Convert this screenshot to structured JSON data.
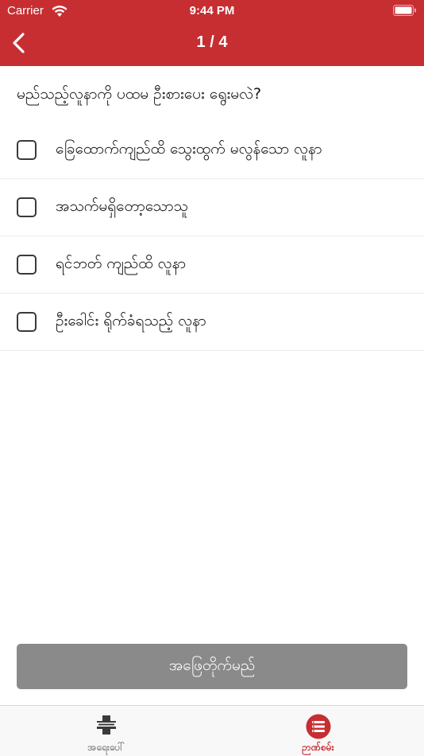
{
  "status_bar": {
    "carrier": "Carrier",
    "time": "9:44 PM",
    "wifi_icon": "wifi-icon",
    "battery_icon": "battery-icon"
  },
  "navbar": {
    "back_icon": "chevron-left-icon",
    "counter": "1 / 4",
    "background_color": "#c62e32"
  },
  "question": {
    "text": "မည်သည့်လူနာကို ပထမ ဦးစားပေး ရွေးမလဲ?"
  },
  "options": [
    {
      "label": "ခြေထောက်ကျည်ထိ သွေးထွက် မလွန်သော လူနာ",
      "checked": false
    },
    {
      "label": "အသက်မရှိတော့သောသူ",
      "checked": false
    },
    {
      "label": "ရင်ဘတ် ကျည်ထိ လူနာ",
      "checked": false
    },
    {
      "label": "ဦးခေါင်း ရိုက်ခံရသည့် လူနာ",
      "checked": false
    }
  ],
  "submit_button": {
    "label": "အဖြေတိုက်မည်",
    "color": "#8a8a8a"
  },
  "tabbar": {
    "tabs": [
      {
        "label": "အရေးပေါ်",
        "icon": "medical-cross-icon",
        "active": false
      },
      {
        "label": "ဉာဏ်စမ်း",
        "icon": "quiz-icon",
        "active": true
      }
    ],
    "active_color": "#c62e32",
    "inactive_color": "#8e8e93"
  }
}
